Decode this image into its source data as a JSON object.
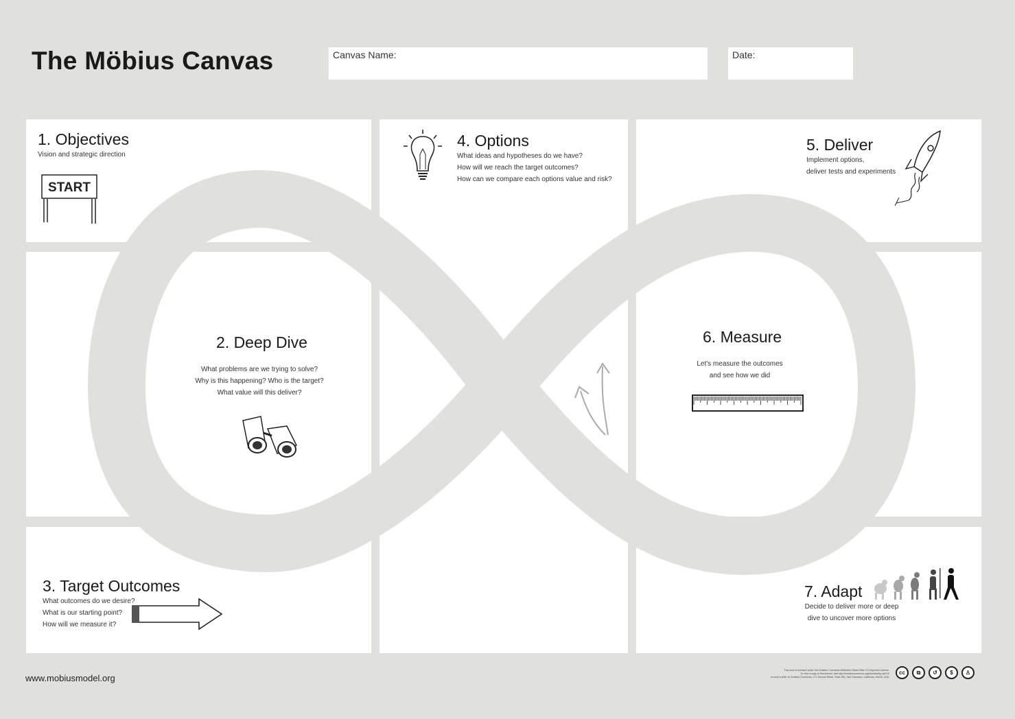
{
  "header": {
    "title": "The Möbius Canvas",
    "canvas_name_label": "Canvas Name:",
    "date_label": "Date:"
  },
  "sections": {
    "objectives": {
      "title": "1. Objectives",
      "lines": [
        "Vision and strategic direction"
      ],
      "sign_text": "START"
    },
    "deep_dive": {
      "title": "2. Deep Dive",
      "lines": [
        "What problems are we trying to solve?",
        "Why is this happening? Who is the target?",
        "What value will this deliver?"
      ]
    },
    "target_outcomes": {
      "title": "3. Target Outcomes",
      "lines": [
        "What outcomes do we desire?",
        "What is our starting point?",
        "How will we measure it?"
      ]
    },
    "options": {
      "title": "4. Options",
      "lines": [
        "What ideas and hypotheses do we have?",
        "How will we reach the target outcomes?",
        "How can we compare each options  value and risk?"
      ]
    },
    "deliver": {
      "title": "5. Deliver",
      "lines": [
        "Implement options,",
        "deliver tests and experiments"
      ]
    },
    "measure": {
      "title": "6. Measure",
      "lines": [
        "Let's measure the outcomes",
        "and see how we did"
      ]
    },
    "adapt": {
      "title": "7. Adapt",
      "lines": [
        "Decide to deliver more or deep",
        "dive to uncover more options"
      ]
    }
  },
  "icons": [
    "start-sign-icon",
    "lightbulb-icon",
    "rocket-icon",
    "binoculars-icon",
    "ruler-icon",
    "arrow-right-icon",
    "curved-arrows-icon",
    "evolution-icon"
  ],
  "footer": {
    "url": "www.mobiusmodel.org",
    "license_lines": [
      "This work is licensed under the Creative Commons Attribution-Share Alike 3.0 Unported License.",
      "To view a copy of this license, visit http://creativecommons.org/licenses/by-sa/3.0/",
      "or send a letter to Creative Commons, 171 Second Street, Suite 300, San Francisco, California, 94105, USA."
    ],
    "cc_badges": [
      "cc",
      "copy",
      "3",
      "nc",
      "by"
    ]
  },
  "colors": {
    "background": "#e0e0dc",
    "panel": "#ffffff",
    "infinity_band": "#e0e0dc",
    "text": "#222222"
  }
}
